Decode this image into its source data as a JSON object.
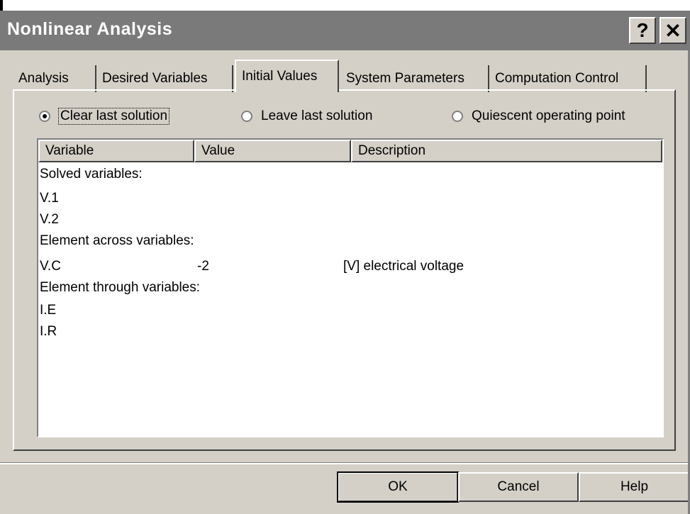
{
  "window": {
    "title": "Nonlinear Analysis",
    "help_glyph": "?",
    "close_glyph": "✕"
  },
  "tabs": [
    {
      "label": "Analysis"
    },
    {
      "label": "Desired Variables"
    },
    {
      "label": "Initial Values",
      "active": true
    },
    {
      "label": "System Parameters"
    },
    {
      "label": "Computation Control"
    }
  ],
  "options": [
    {
      "label": "Clear last solution",
      "selected": true
    },
    {
      "label": "Leave last solution",
      "selected": false
    },
    {
      "label": "Quiescent operating point",
      "selected": false
    }
  ],
  "table": {
    "columns": [
      "Variable",
      "Value",
      "Description"
    ],
    "rows": [
      {
        "variable": "Solved variables:",
        "value": "",
        "description": ""
      },
      {
        "variable": "V.1",
        "value": "",
        "description": ""
      },
      {
        "variable": "V.2",
        "value": "",
        "description": ""
      },
      {
        "variable": "Element across variables:",
        "value": "",
        "description": ""
      },
      {
        "variable": "V.C",
        "value": "-2",
        "description": "[V] electrical voltage"
      },
      {
        "variable": "Element through variables:",
        "value": "",
        "description": ""
      },
      {
        "variable": "I.E",
        "value": "",
        "description": ""
      },
      {
        "variable": "I.R",
        "value": "",
        "description": ""
      }
    ]
  },
  "buttons": {
    "ok": "OK",
    "cancel": "Cancel",
    "help": "Help"
  }
}
